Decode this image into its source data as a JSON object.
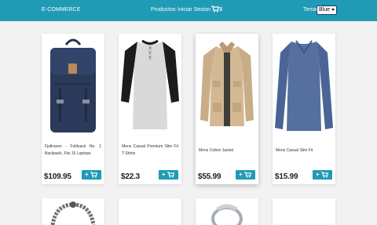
{
  "navbar": {
    "brand": "E-COMMERCE",
    "links": [
      "Productos",
      "Iniciar Sesion"
    ],
    "cart_count": "3",
    "theme_label": "Tema:",
    "theme_value": "Blue"
  },
  "colors": {
    "navbar": "#1f9bb5",
    "button": "#1f9bb5",
    "page_bg": "#f2f2f2"
  },
  "products": [
    {
      "title": "Fjallraven - Foldsack No. 1 Backpack, Fits 15 Laptops",
      "price": "$109.95",
      "button_label": "+"
    },
    {
      "title": "Mens Casual Premium Slim Fit T-Shirts",
      "price": "$22.3",
      "button_label": "+"
    },
    {
      "title": "Mens Cotton Jacket",
      "price": "$55.99",
      "button_label": "+"
    },
    {
      "title": "Mens Casual Slim Fit",
      "price": "$15.99",
      "button_label": "+"
    }
  ]
}
